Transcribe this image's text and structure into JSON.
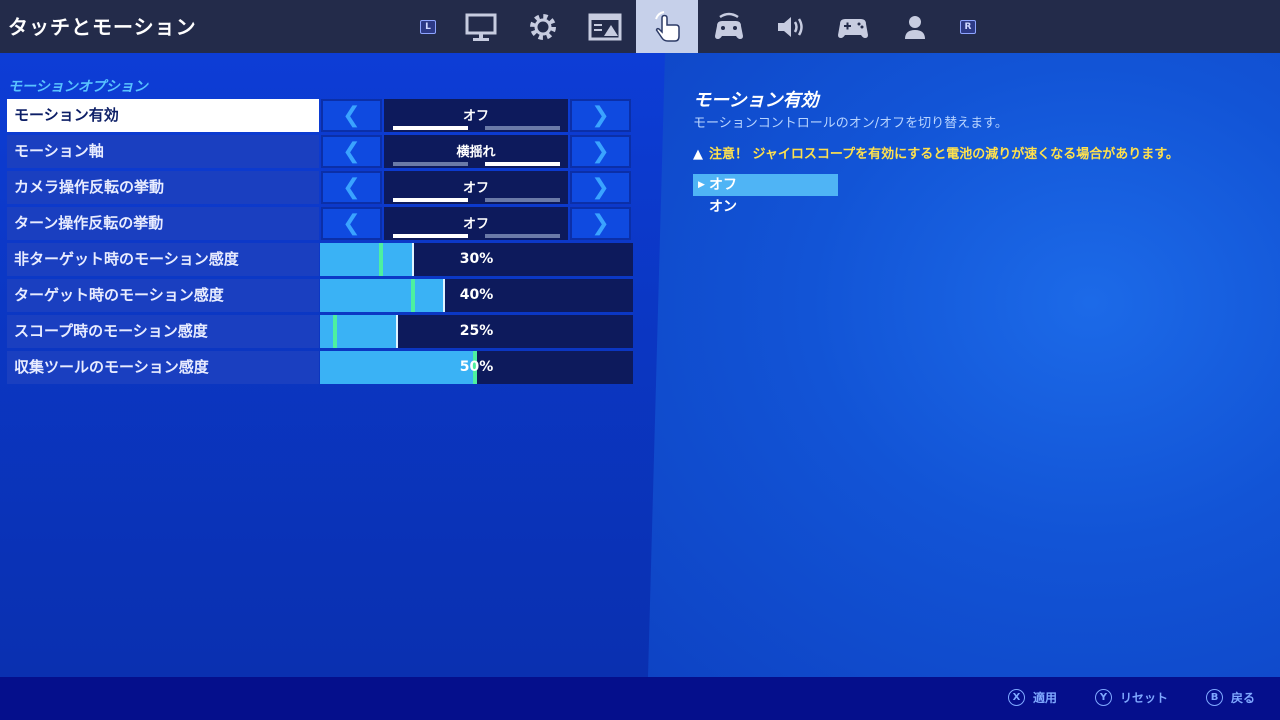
{
  "header": {
    "title": "タッチとモーション",
    "left_shoulder": "L",
    "right_shoulder": "R",
    "tabs": [
      {
        "icon": "monitor-icon"
      },
      {
        "icon": "gear-icon"
      },
      {
        "icon": "hud-icon"
      },
      {
        "icon": "touch-icon",
        "active": true
      },
      {
        "icon": "controller-wireless-icon"
      },
      {
        "icon": "speaker-icon"
      },
      {
        "icon": "gamepad-icon"
      },
      {
        "icon": "user-icon"
      }
    ]
  },
  "section": {
    "title": "モーションオプション"
  },
  "rows": [
    {
      "label": "モーション有効",
      "value": "オフ",
      "option_index": 0,
      "selected": true
    },
    {
      "label": "モーション軸",
      "value": "横揺れ",
      "option_index": 1
    },
    {
      "label": "カメラ操作反転の挙動",
      "value": "オフ",
      "option_index": 0
    },
    {
      "label": "ターン操作反転の挙動",
      "value": "オフ",
      "option_index": 0
    }
  ],
  "sliders": [
    {
      "label": "非ターゲット時のモーション感度",
      "value": "30%",
      "fraction": 0.3,
      "marker_fraction": 0.19
    },
    {
      "label": "ターゲット時のモーション感度",
      "value": "40%",
      "fraction": 0.4,
      "marker_fraction": 0.29
    },
    {
      "label": "スコープ時のモーション感度",
      "value": "25%",
      "fraction": 0.25,
      "marker_fraction": 0.04
    },
    {
      "label": "収集ツールのモーション感度",
      "value": "50%",
      "fraction": 0.5,
      "marker_fraction": 0.49
    }
  ],
  "detail": {
    "title": "モーション有効",
    "description": "モーションコントロールのオン/オフを切り替えます。",
    "warning": "注意！ ジャイロスコープを有効にすると電池の減りが速くなる場合があります。",
    "options": [
      "オフ",
      "オン"
    ],
    "selected_option": "オフ"
  },
  "footer": {
    "apply_button": "X",
    "apply_label": "適用",
    "reset_button": "Y",
    "reset_label": "リセット",
    "back_button": "B",
    "back_label": "戻る"
  },
  "colors": {
    "accent": "#3ab2f5",
    "marker": "#4df0a0",
    "warning": "#ffe14d"
  }
}
